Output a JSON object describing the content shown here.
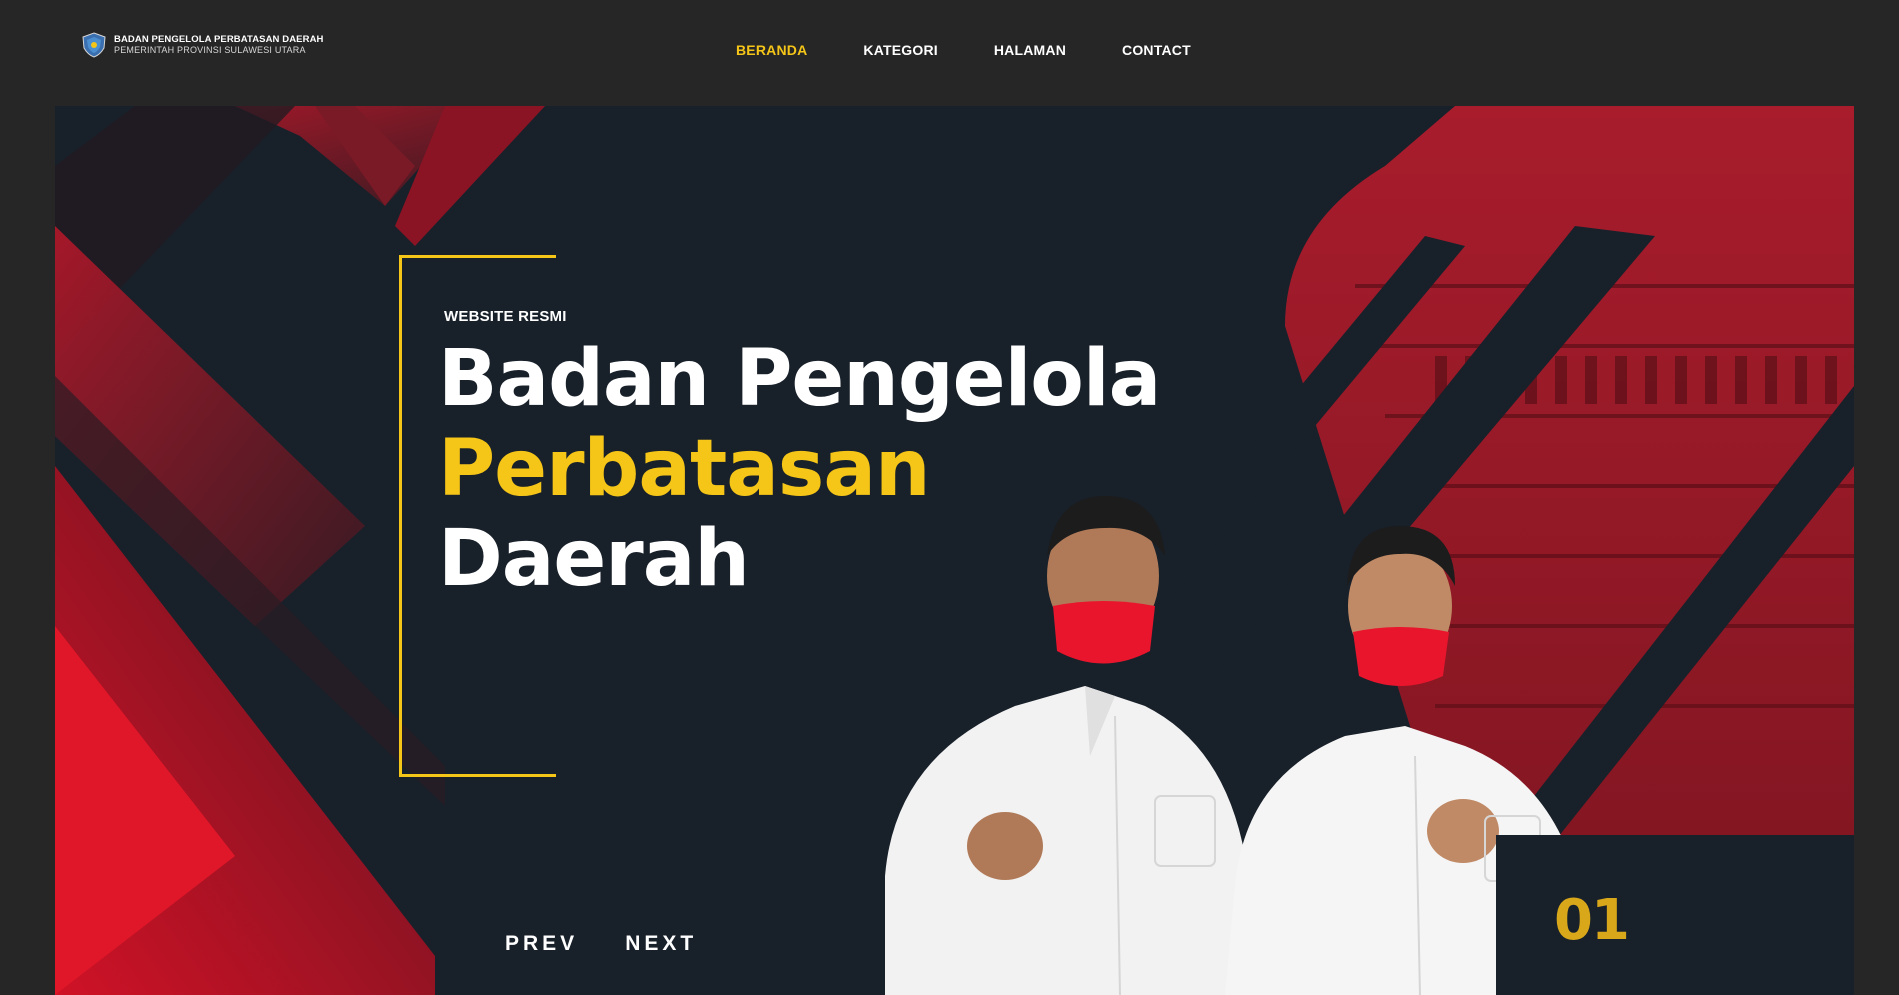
{
  "brand": {
    "title": "BADAN PENGELOLA PERBATASAN DAERAH",
    "subtitle": "PEMERINTAH PROVINSI SULAWESI UTARA",
    "logo_icon": "shield-emblem-icon"
  },
  "nav": {
    "items": [
      {
        "label": "BERANDA",
        "active": true
      },
      {
        "label": "KATEGORI",
        "active": false
      },
      {
        "label": "HALAMAN",
        "active": false
      },
      {
        "label": "CONTACT",
        "active": false
      }
    ]
  },
  "hero": {
    "eyebrow": "WEBSITE RESMI",
    "headline_line1": "Badan Pengelola",
    "headline_line2": "Perbatasan",
    "headline_line3": "Daerah",
    "prev_label": "PREV",
    "next_label": "NEXT",
    "slide_number": "01"
  },
  "colors": {
    "background": "#262626",
    "hero_bg": "#18202a",
    "accent": "#f5c518",
    "red": "#c0152b"
  }
}
